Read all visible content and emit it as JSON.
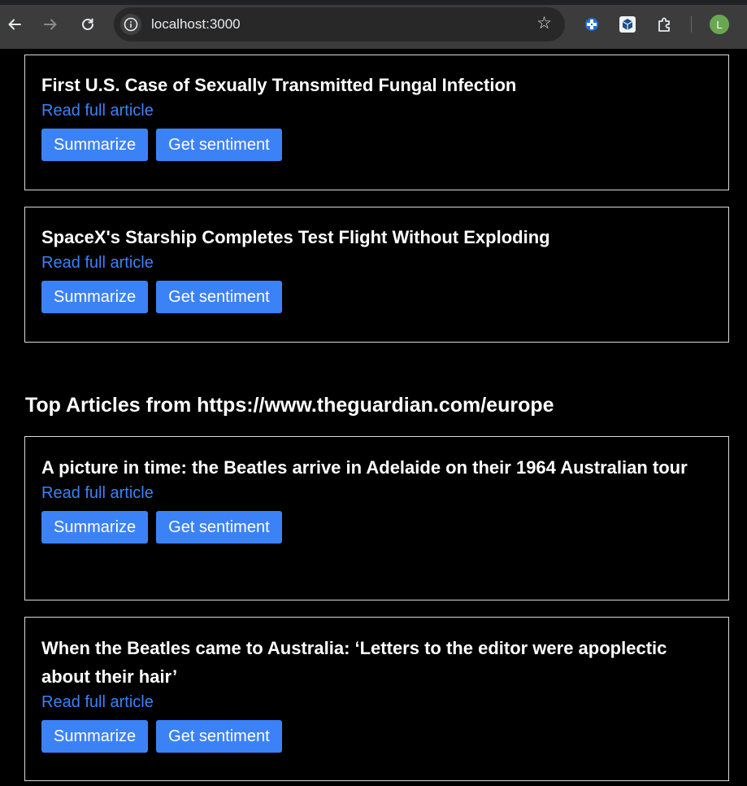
{
  "browser": {
    "url": "localhost:3000",
    "profile_initial": "L"
  },
  "section": {
    "title": "Top Articles from https://www.theguardian.com/europe"
  },
  "articles": [
    {
      "title": "First U.S. Case of Sexually Transmitted Fungal Infection",
      "link": "Read full article",
      "summarize": "Summarize",
      "sentiment": "Get sentiment"
    },
    {
      "title": "SpaceX's Starship Completes Test Flight Without Exploding",
      "link": "Read full article",
      "summarize": "Summarize",
      "sentiment": "Get sentiment"
    },
    {
      "title": "A picture in time: the Beatles arrive in Adelaide on their 1964 Australian tour",
      "link": "Read full article",
      "summarize": "Summarize",
      "sentiment": "Get sentiment"
    },
    {
      "title": "When the Beatles came to Australia: ‘Letters to the editor were apoplectic about their hair’",
      "link": "Read full article",
      "summarize": "Summarize",
      "sentiment": "Get sentiment"
    }
  ],
  "icons": {
    "back": "arrow-left",
    "forward": "arrow-right",
    "reload": "reload",
    "site_info": "info-circle",
    "bookmark": "star-outline",
    "extension_1": "blue-puzzle-extension",
    "extension_2": "cube-extension",
    "extensions_menu": "puzzle-piece"
  },
  "colors": {
    "accent": "#3b82f6",
    "background": "#000000",
    "card_border": "#d9d9d9",
    "avatar": "#6aa84f"
  }
}
